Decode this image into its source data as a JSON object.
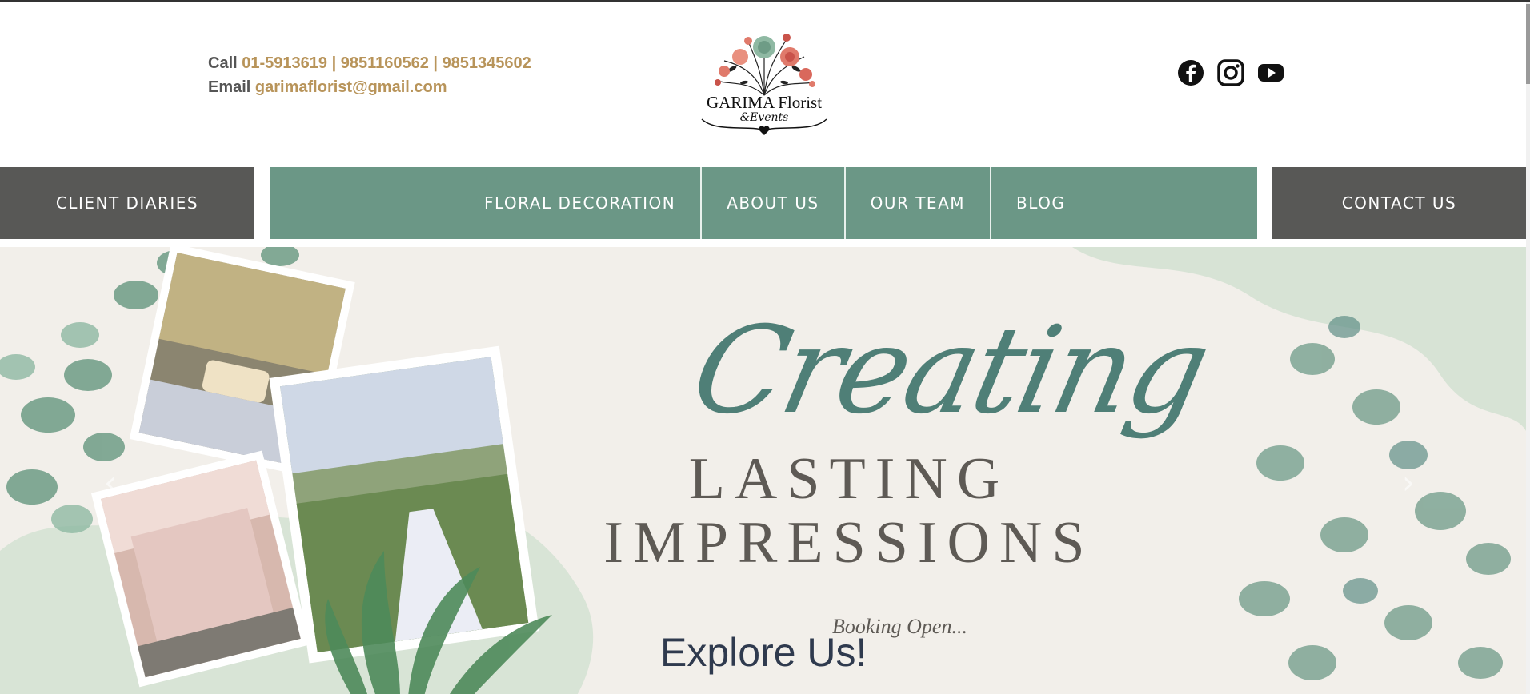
{
  "header": {
    "call_label": "Call",
    "phones": "01-5913619 | 9851160562 | 9851345602",
    "email_label": "Email",
    "email": "garimaflorist@gmail.com",
    "logo_line1": "GARIMA Florist",
    "logo_line2": "&Events",
    "social_icons": [
      "facebook-icon",
      "instagram-icon",
      "youtube-icon"
    ]
  },
  "nav": {
    "left": "CLIENT DIARIES",
    "items": [
      "FLORAL DECORATION",
      "ABOUT US",
      "OUR TEAM",
      "BLOG"
    ],
    "right": "CONTACT US"
  },
  "hero": {
    "script": "Creating",
    "line1": "LASTING",
    "line2": "IMPRESSIONS",
    "booking": "Booking Open...",
    "explore": "Explore Us!"
  },
  "colors": {
    "nav_green": "#6b9786",
    "nav_gray": "#585856",
    "gold_text": "#b8945a",
    "hero_bg": "#f2efea"
  }
}
